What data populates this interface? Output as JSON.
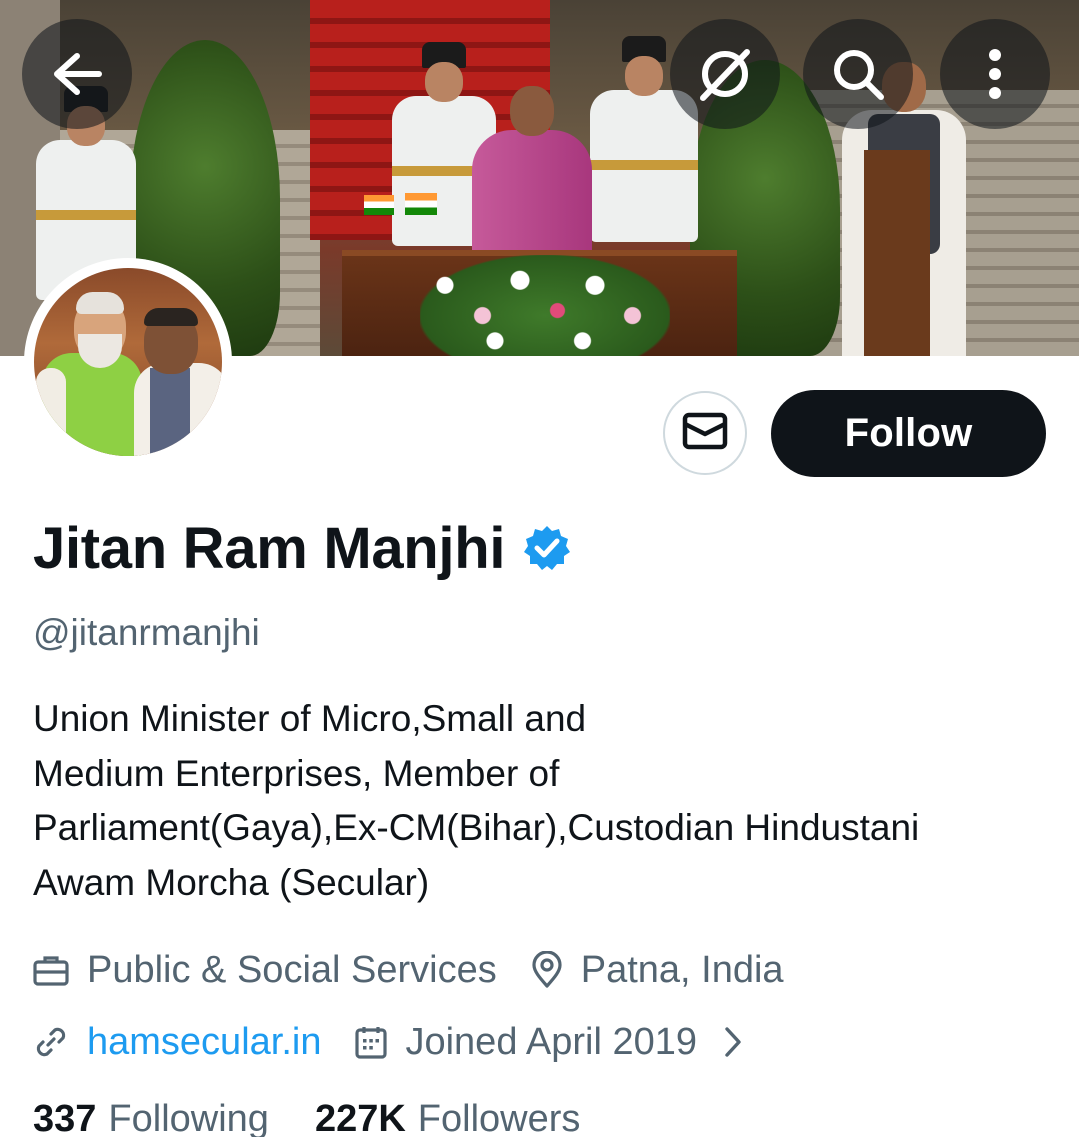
{
  "profile": {
    "name": "Jitan Ram Manjhi",
    "handle": "@jitanrmanjhi",
    "verified": true,
    "bio_lines": [
      "Union Minister of Micro,Small and",
      "Medium Enterprises, Member of",
      "Parliament(Gaya),Ex-CM(Bihar),Custodian Hindustani",
      "Awam Morcha (Secular)"
    ],
    "category": "Public & Social Services",
    "location": "Patna, India",
    "website": "hamsecular.in",
    "joined": "Joined April 2019"
  },
  "actions": {
    "follow_label": "Follow"
  },
  "stats": {
    "following_count": "337",
    "following_label": "Following",
    "followers_count": "227K",
    "followers_label": "Followers"
  },
  "icons": {
    "back": "arrow-left-icon",
    "grok": "grok-icon",
    "search": "search-icon",
    "more": "more-vertical-icon",
    "message": "envelope-icon",
    "verified": "verified-badge-icon",
    "category": "briefcase-icon",
    "location": "location-pin-icon",
    "website": "link-icon",
    "joined": "calendar-icon",
    "chevron": "chevron-right-icon"
  },
  "colors": {
    "text_primary": "#0f1419",
    "text_secondary": "#536471",
    "accent_blue": "#1d9bf0",
    "button_dark": "#0f1419"
  }
}
